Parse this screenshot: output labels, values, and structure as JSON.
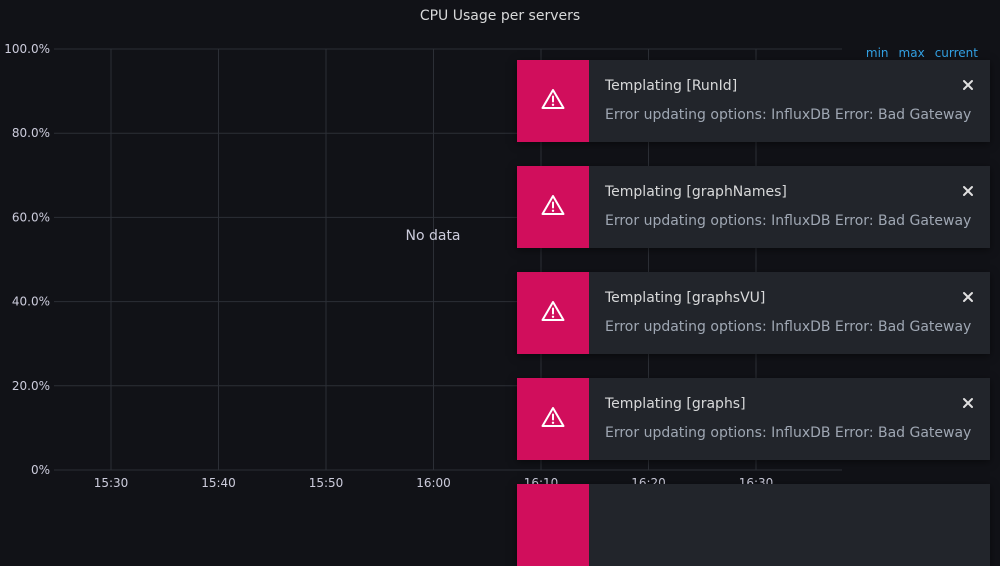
{
  "panel": {
    "title": "CPU Usage per servers",
    "no_data": "No data",
    "legend": {
      "min": "min",
      "max": "max",
      "current": "current"
    }
  },
  "chart_data": {
    "type": "line",
    "title": "CPU Usage per servers",
    "xlabel": "",
    "ylabel": "",
    "x_ticks": [
      "15:30",
      "15:40",
      "15:50",
      "16:00",
      "16:10",
      "16:20",
      "16:30"
    ],
    "y_ticks": [
      "0%",
      "20.0%",
      "40.0%",
      "60.0%",
      "80.0%",
      "100.0%"
    ],
    "ylim": [
      0,
      100
    ],
    "grid": true,
    "series": []
  },
  "toasts": [
    {
      "title": "Templating [RunId]",
      "text": "Error updating options: InfluxDB Error: Bad Gateway",
      "icon": "warning-icon"
    },
    {
      "title": "Templating [graphNames]",
      "text": "Error updating options: InfluxDB Error: Bad Gateway",
      "icon": "warning-icon"
    },
    {
      "title": "Templating [graphsVU]",
      "text": "Error updating options: InfluxDB Error: Bad Gateway",
      "icon": "warning-icon"
    },
    {
      "title": "Templating [graphs]",
      "text": "Error updating options: InfluxDB Error: Bad Gateway",
      "icon": "warning-icon"
    }
  ],
  "colors": {
    "background": "#111217",
    "toast_accent": "#d10e5c",
    "legend_link": "#33a2e5"
  }
}
